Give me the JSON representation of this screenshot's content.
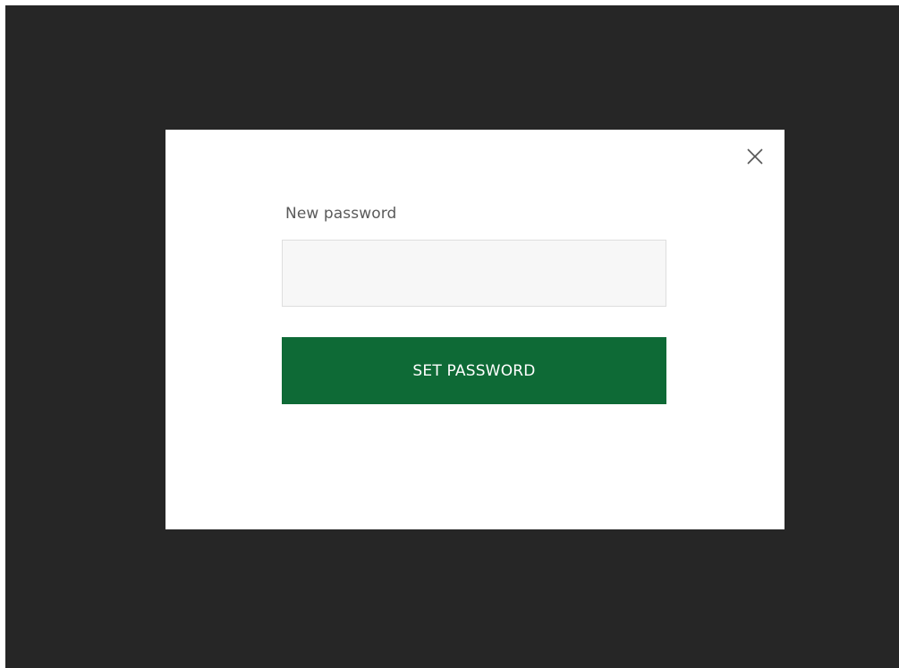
{
  "colors": {
    "backdrop": "#262626",
    "modal_background": "#ffffff",
    "primary_button": "#0e6a36",
    "input_background": "#f7f7f7",
    "label_text": "#5a5a5a"
  },
  "dialog": {
    "close_icon": "close-icon",
    "password_field": {
      "label": "New password",
      "value": "",
      "placeholder": ""
    },
    "submit_button": {
      "label": "SET PASSWORD"
    }
  }
}
